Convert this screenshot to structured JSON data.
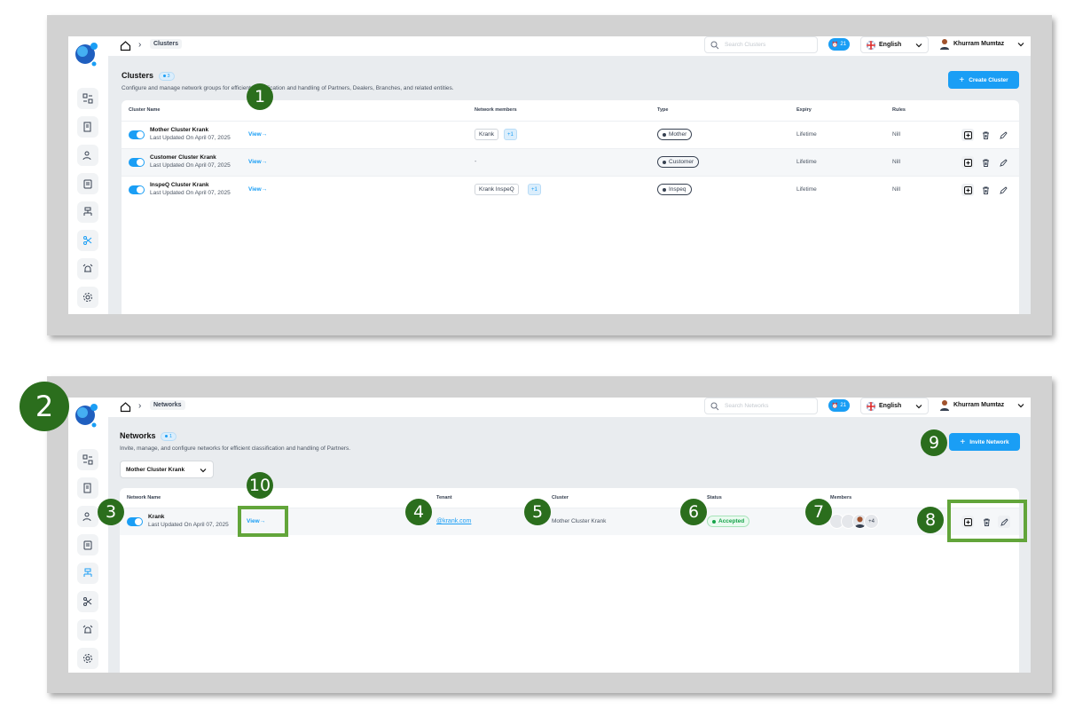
{
  "topbar": {
    "user_name": "Khurram Mumtaz",
    "language": "English",
    "notifications": "21"
  },
  "screen1": {
    "breadcrumb": "Clusters",
    "search_placeholder": "Search Clusters",
    "title": "Clusters",
    "count": "3",
    "description": "Configure and manage network groups for efficient classification and handling of Partners, Dealers, Branches, and related entities.",
    "create_label": "Create Cluster",
    "columns": [
      "Cluster Name",
      "Network members",
      "Type",
      "Expiry",
      "Rules"
    ],
    "rows": [
      {
        "name": "Mother Cluster Krank",
        "updated": "Last Updated On April 07, 2025",
        "view": "View",
        "members": [
          "Krank"
        ],
        "more": "+1",
        "type": "Mother",
        "expiry": "Lifetime",
        "rules": "Nill"
      },
      {
        "name": "Customer Cluster Krank",
        "updated": "Last Updated On April 07, 2025",
        "view": "View",
        "members": [],
        "empty": "-",
        "type": "Customer",
        "expiry": "Lifetime",
        "rules": "Nill"
      },
      {
        "name": "InspeQ Cluster Krank",
        "updated": "Last Updated On April 07, 2025",
        "view": "View",
        "members": [
          "Krank InspeQ"
        ],
        "more": "+1",
        "type": "Inspeq",
        "expiry": "Lifetime",
        "rules": "Nill"
      }
    ]
  },
  "screen2": {
    "breadcrumb": "Networks",
    "search_placeholder": "Search Networks",
    "title": "Networks",
    "count": "1",
    "description": "Invite, manage, and configure networks for efficient classification and handling of Partners.",
    "invite_label": "Invite Network",
    "filter_value": "Mother Cluster Krank",
    "columns": [
      "Network Name",
      "Tenant",
      "Cluster",
      "Status",
      "Members"
    ],
    "rows": [
      {
        "name": "Krank",
        "updated": "Last Updated On April 07, 2025",
        "view": "View",
        "tenant": "@krank.com",
        "cluster": "Mother Cluster Krank",
        "status": "Accepted",
        "members_more": "+4"
      }
    ]
  },
  "annotations": {
    "m1": "1",
    "m2": "2",
    "m3": "3",
    "m4": "4",
    "m5": "5",
    "m6": "6",
    "m7": "7",
    "m8": "8",
    "m9": "9",
    "m10": "10"
  },
  "colors": {
    "accent": "#1a9ef5",
    "marker": "#2b6e1d",
    "highlight": "#62a53a",
    "success": "#16a34a"
  },
  "icons": {
    "sidebar": [
      "dashboard-icon",
      "report-icon",
      "users-icon",
      "clipboard-icon",
      "hierarchy-icon",
      "cluster-icon",
      "alarm-icon",
      "settings-icon"
    ],
    "row_actions": [
      "add-square-icon",
      "trash-icon",
      "pencil-icon"
    ]
  }
}
